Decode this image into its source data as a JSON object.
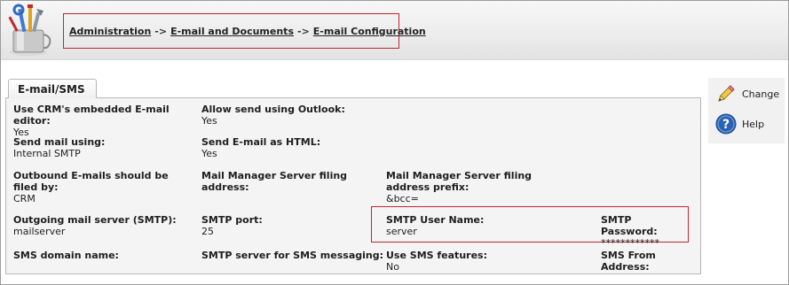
{
  "breadcrumb": {
    "items": [
      "Administration",
      "E-mail and Documents",
      "E-mail Configuration"
    ],
    "separator": "->"
  },
  "tab": {
    "label": "E-mail/SMS"
  },
  "fields": {
    "embedded_editor": {
      "label": "Use CRM's embedded E-mail editor:",
      "value": "Yes"
    },
    "allow_outlook": {
      "label": "Allow send using Outlook:",
      "value": "Yes"
    },
    "send_mail_using": {
      "label": "Send mail using:",
      "value": "Internal SMTP"
    },
    "send_as_html": {
      "label": "Send E-mail as HTML:",
      "value": "Yes"
    },
    "outbound_filed_by": {
      "label": "Outbound E-mails should be filed by:",
      "value": "CRM"
    },
    "mm_filing_address": {
      "label": "Mail Manager Server filing address:",
      "value": ""
    },
    "mm_filing_prefix": {
      "label": "Mail Manager Server filing address prefix:",
      "value": "&bcc="
    },
    "smtp_server": {
      "label": "Outgoing mail server (SMTP):",
      "value": "mailserver"
    },
    "smtp_port": {
      "label": "SMTP port:",
      "value": "25"
    },
    "smtp_user": {
      "label": "SMTP User Name:",
      "value": "server"
    },
    "smtp_password": {
      "label": "SMTP Password:",
      "value": "************"
    },
    "sms_domain": {
      "label": "SMS domain name:",
      "value": ""
    },
    "sms_smtp_server": {
      "label": "SMTP server for SMS messaging:",
      "value": ""
    },
    "use_sms": {
      "label": "Use SMS features:",
      "value": "No"
    },
    "sms_from": {
      "label": "SMS From Address:",
      "value": ""
    }
  },
  "actions": {
    "change": {
      "label": "Change",
      "icon": "pencil-icon"
    },
    "help": {
      "label": "Help",
      "icon": "help-icon"
    }
  },
  "colors": {
    "highlight": "#c0272d",
    "panel": "#f4f4f4",
    "help_icon": "#2a63b6"
  }
}
